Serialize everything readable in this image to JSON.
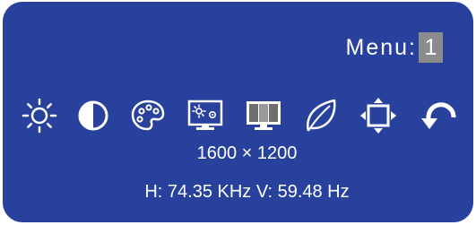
{
  "osd": {
    "menu_label": "Menu:",
    "menu_number": "1",
    "background_color": "#28419c",
    "highlight_color": "#8c8c8c"
  },
  "icons": [
    "brightness-icon",
    "contrast-icon",
    "color-palette-icon",
    "picture-adjust-icon",
    "display-mode-icon",
    "eco-leaf-icon",
    "position-icon",
    "reset-icon"
  ],
  "status": {
    "resolution": "1600 × 1200",
    "frequency": "H: 74.35 KHz  V: 59.48 Hz"
  }
}
